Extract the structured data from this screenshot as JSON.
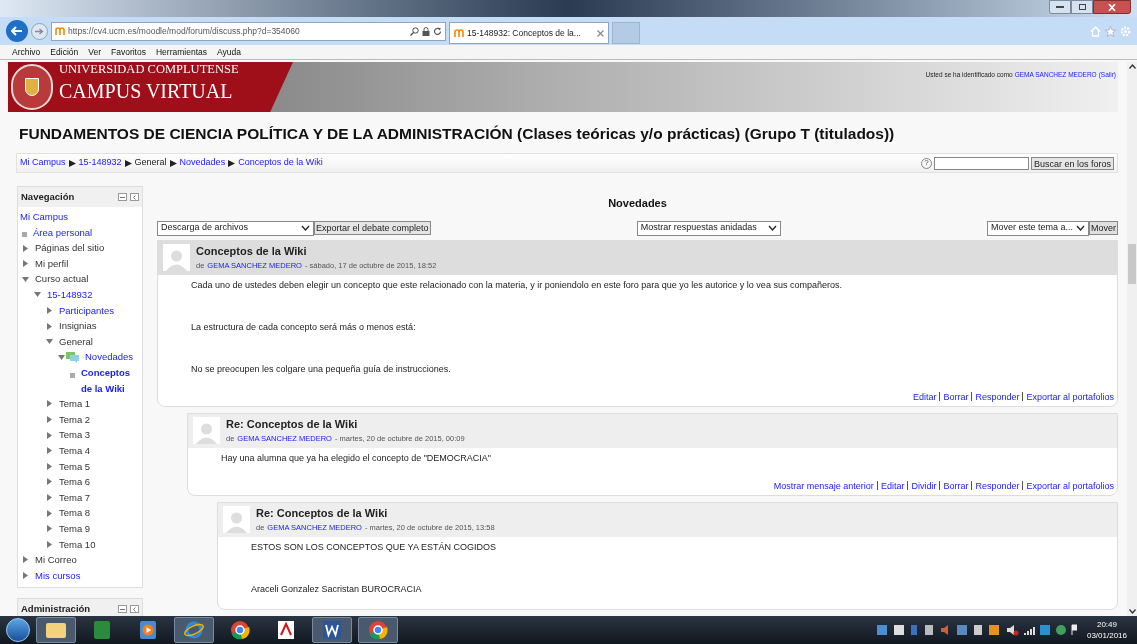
{
  "browser": {
    "url": "https://cv4.ucm.es/moodle/mod/forum/discuss.php?d=354060",
    "tab": "15-148932: Conceptos de la...",
    "menu": [
      "Archivo",
      "Edición",
      "Ver",
      "Favoritos",
      "Herramientas",
      "Ayuda"
    ]
  },
  "banner": {
    "university": "UNIVERSIDAD COMPLUTENSE",
    "campus": "CAMPUS VIRTUAL",
    "login_prefix": "Usted se ha identificado como",
    "user": "GEMA SANCHEZ MEDERO",
    "logout": "(Salir)"
  },
  "course_title": "FUNDAMENTOS DE CIENCIA POLÍTICA Y DE LA ADMINISTRACIÓN (Clases teóricas y/o prácticas) (Grupo T (titulados))",
  "breadcrumb": [
    {
      "label": "Mi Campus",
      "link": true
    },
    {
      "label": "15-148932",
      "link": true
    },
    {
      "label": "General",
      "link": false
    },
    {
      "label": "Novedades",
      "link": true
    },
    {
      "label": "Conceptos de la Wiki",
      "link": true
    }
  ],
  "search": {
    "help": "?",
    "button": "Buscar en los foros"
  },
  "navigation": {
    "title": "Navegación",
    "items": [
      {
        "label": "Mi Campus",
        "kind": "root",
        "link": true
      },
      {
        "label": "Área personal",
        "kind": "leaf",
        "link": true
      },
      {
        "label": "Páginas del sitio",
        "kind": "branch",
        "link": false,
        "expanded": false
      },
      {
        "label": "Mi perfil",
        "kind": "branch",
        "link": false,
        "expanded": false
      },
      {
        "label": "Curso actual",
        "kind": "branch",
        "link": false,
        "expanded": true,
        "children": [
          {
            "label": "15-148932",
            "kind": "branch",
            "link": true,
            "expanded": true,
            "children": [
              {
                "label": "Participantes",
                "kind": "branch",
                "link": true,
                "expanded": false
              },
              {
                "label": "Insignias",
                "kind": "branch",
                "link": false,
                "expanded": false
              },
              {
                "label": "General",
                "kind": "branch",
                "link": false,
                "expanded": true,
                "children": [
                  {
                    "label": "Novedades",
                    "kind": "forum",
                    "link": true,
                    "expanded": true,
                    "children": [
                      {
                        "label": "Conceptos de la Wiki",
                        "kind": "current",
                        "link": true
                      }
                    ]
                  }
                ]
              },
              {
                "label": "Tema 1",
                "kind": "branch",
                "link": false,
                "expanded": false
              },
              {
                "label": "Tema 2",
                "kind": "branch",
                "link": false,
                "expanded": false
              },
              {
                "label": "Tema 3",
                "kind": "branch",
                "link": false,
                "expanded": false
              },
              {
                "label": "Tema 4",
                "kind": "branch",
                "link": false,
                "expanded": false
              },
              {
                "label": "Tema 5",
                "kind": "branch",
                "link": false,
                "expanded": false
              },
              {
                "label": "Tema 6",
                "kind": "branch",
                "link": false,
                "expanded": false
              },
              {
                "label": "Tema 7",
                "kind": "branch",
                "link": false,
                "expanded": false
              },
              {
                "label": "Tema 8",
                "kind": "branch",
                "link": false,
                "expanded": false
              },
              {
                "label": "Tema 9",
                "kind": "branch",
                "link": false,
                "expanded": false
              },
              {
                "label": "Tema 10",
                "kind": "branch",
                "link": false,
                "expanded": false
              }
            ]
          }
        ]
      },
      {
        "label": "Mi Correo",
        "kind": "branch",
        "link": false,
        "expanded": false
      },
      {
        "label": "Mis cursos",
        "kind": "branch",
        "link": true,
        "expanded": false
      }
    ]
  },
  "administration": {
    "title": "Administración"
  },
  "forum": {
    "title": "Novedades",
    "download": "Descarga de archivos",
    "export": "Exportar el debate completo",
    "display": "Mostrar respuestas anidadas",
    "move_select": "Mover este tema a...",
    "move_button": "Mover"
  },
  "posts": [
    {
      "title": "Conceptos de la Wiki",
      "by": "de",
      "author": "GEMA SANCHEZ MEDERO",
      "date": "- sábado, 17 de octubre de 2015, 18:52",
      "paragraphs": [
        "Cada uno de ustedes deben elegir un concepto que este relacionado con la materia, y ir poniendolo en este foro para que yo les autorice y lo vea sus compañeros.",
        "La estructura de cada concepto será más o menos está:",
        "No se preocupen les colgare una pequeña guía de instrucciones."
      ],
      "actions": [
        "Editar",
        "Borrar",
        "Responder",
        "Exportar al portafolios"
      ],
      "replies": [
        {
          "title": "Re: Conceptos de la Wiki",
          "by": "de",
          "author": "GEMA SANCHEZ MEDERO",
          "date": "- martes, 20 de octubre de 2015, 00:09",
          "paragraphs": [
            "Hay una alumna que ya ha elegido el concepto de \"DEMOCRACIA\""
          ],
          "actions": [
            "Mostrar mensaje anterior",
            "Editar",
            "Dividir",
            "Borrar",
            "Responder",
            "Exportar al portafolios"
          ],
          "replies": [
            {
              "title": "Re: Conceptos de la Wiki",
              "by": "de",
              "author": "GEMA SANCHEZ MEDERO",
              "date": "- martes, 20 de octubre de 2015, 13:58",
              "paragraphs": [
                "ESTOS SON LOS CONCEPTOS QUE YA ESTÁN COGIDOS",
                "Araceli Gonzalez Sacristan BUROCRACIA"
              ]
            }
          ]
        }
      ]
    }
  ],
  "taskbar": {
    "time": "20:49",
    "date": "03/01/2016"
  }
}
